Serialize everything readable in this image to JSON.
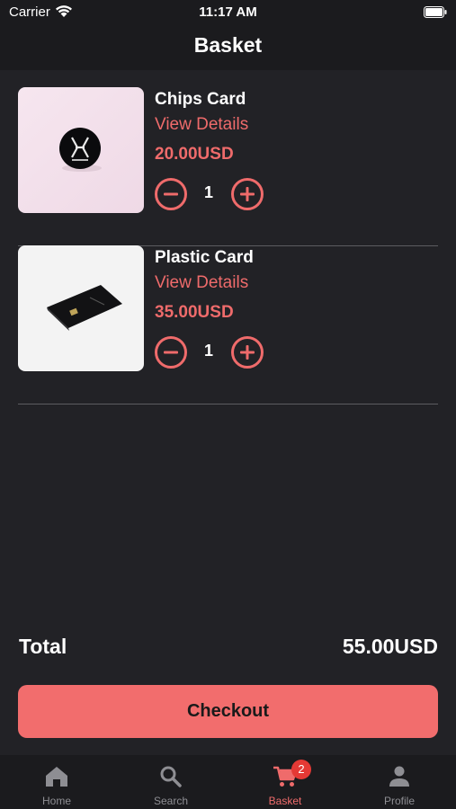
{
  "status_bar": {
    "carrier": "Carrier",
    "time": "11:17 AM"
  },
  "header": {
    "title": "Basket"
  },
  "basket": {
    "items": [
      {
        "name": "Chips Card",
        "details_label": "View Details",
        "price": "20.00USD",
        "quantity": "1",
        "icon": "chips-card-image"
      },
      {
        "name": "Plastic Card",
        "details_label": "View Details",
        "price": "35.00USD",
        "quantity": "1",
        "icon": "plastic-card-image"
      }
    ]
  },
  "summary": {
    "total_label": "Total",
    "total_value": "55.00USD",
    "checkout_label": "Checkout"
  },
  "tabs": [
    {
      "label": "Home",
      "icon": "home-icon"
    },
    {
      "label": "Search",
      "icon": "search-icon"
    },
    {
      "label": "Basket",
      "icon": "cart-icon",
      "badge": "2",
      "active": true
    },
    {
      "label": "Profile",
      "icon": "person-icon"
    }
  ],
  "colors": {
    "accent": "#ef6b6b",
    "background": "#222226",
    "bar": "#1b1b1e",
    "badge": "#e53935"
  }
}
